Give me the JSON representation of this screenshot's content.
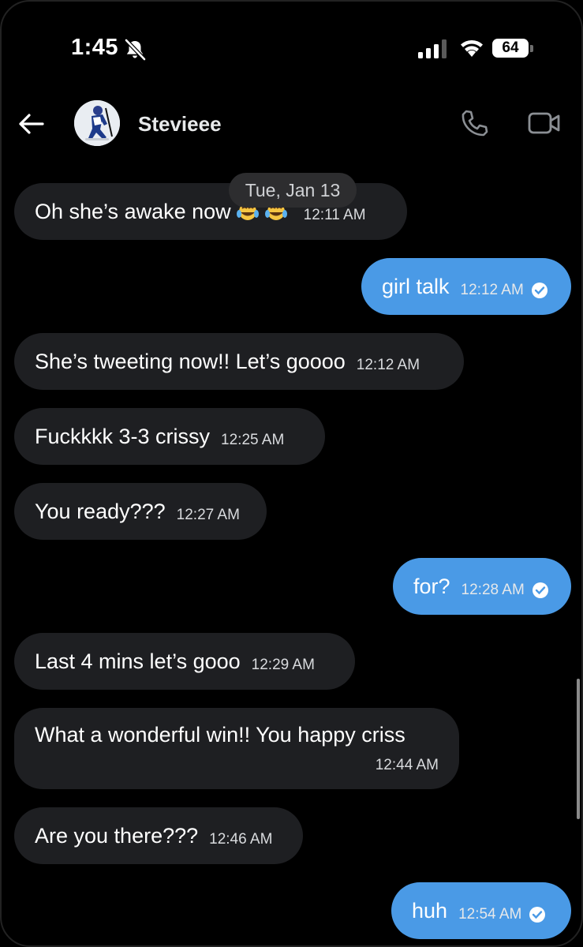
{
  "status_bar": {
    "time": "1:45",
    "battery": "64"
  },
  "header": {
    "contact_name": "Stevieee"
  },
  "date_divider": "Tue, Jan 13",
  "messages": [
    {
      "direction": "in",
      "text": "Oh she’s awake now",
      "emoji": "face-with-tears-of-joy x2",
      "time": "12:11 AM"
    },
    {
      "direction": "out",
      "text": "girl talk",
      "time": "12:12 AM"
    },
    {
      "direction": "in",
      "text": "She’s tweeting now!! Let’s goooo",
      "time": "12:12 AM"
    },
    {
      "direction": "in",
      "text": "Fuckkkk 3-3 crissy",
      "time": "12:25 AM"
    },
    {
      "direction": "in",
      "text": "You ready???",
      "time": "12:27 AM"
    },
    {
      "direction": "out",
      "text": "for?",
      "time": "12:28 AM"
    },
    {
      "direction": "in",
      "text": "Last 4 mins let’s gooo",
      "time": "12:29 AM"
    },
    {
      "direction": "in",
      "text": "What a wonderful win!! You happy criss",
      "time": "12:44 AM"
    },
    {
      "direction": "in",
      "text": "Are you there???",
      "time": "12:46 AM"
    },
    {
      "direction": "out",
      "text": "huh",
      "time": "12:54 AM"
    }
  ],
  "colors": {
    "background": "#000000",
    "incoming_bubble": "#1e1f22",
    "outgoing_bubble": "#4a9ae6"
  }
}
